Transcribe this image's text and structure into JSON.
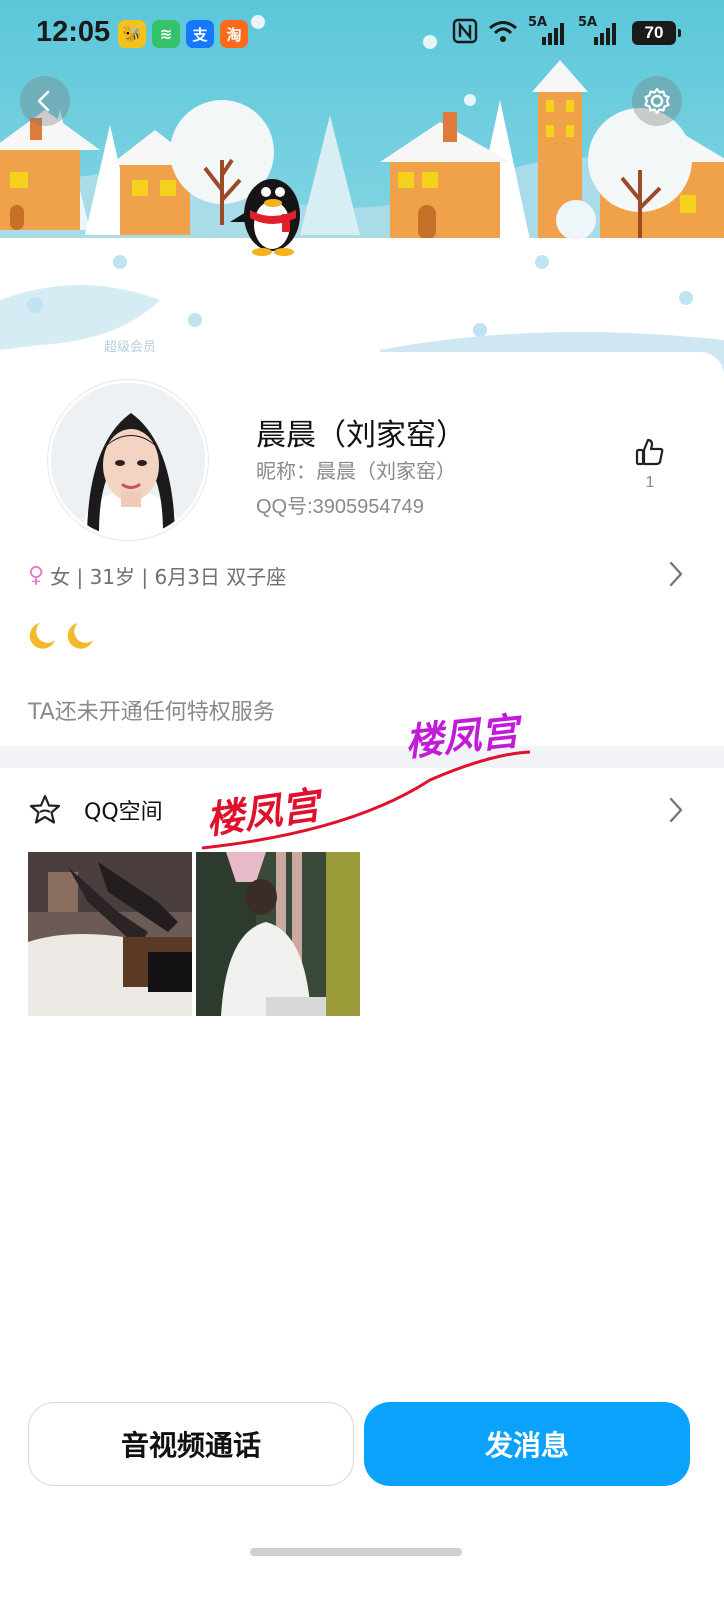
{
  "status_bar": {
    "time": "12:05",
    "apps": [
      {
        "name": "taobao-bee-app",
        "color": "#f6c21a",
        "glyph": "🐝"
      },
      {
        "name": "wifi-share-app",
        "color": "#34c36a",
        "glyph": "≋"
      },
      {
        "name": "alipay-app",
        "color": "#1677ff",
        "glyph": "支"
      },
      {
        "name": "taobao-flash-app",
        "color": "#ff6a1a",
        "glyph": "淘"
      }
    ],
    "signal_1_label": "5A",
    "signal_2_label": "5A",
    "battery": "70"
  },
  "banner": {
    "watermark_text": "超级会员"
  },
  "profile": {
    "name": "晨晨（刘家窑）",
    "nickname": "昵称：晨晨（刘家窑）",
    "qq_number": "QQ号:3905954749",
    "like_count": "1",
    "gender_symbol": "♀",
    "info": "女 | 31岁 | 6月3日 双子座",
    "signature_emoji": [
      "🌙",
      "🌙"
    ],
    "privilege_text": "TA还未开通任何特权服务"
  },
  "qzone": {
    "label": "QQ空间"
  },
  "watermarks": {
    "text_1": "楼凤宫",
    "text_2": "楼凤宫",
    "color_1": "#e0112d",
    "color_2": "#c21bd8"
  },
  "actions": {
    "call_label": "音视频通话",
    "message_label": "发消息"
  },
  "colors": {
    "primary": "#0aa2fb",
    "banner_sky": "#5bc7d9"
  }
}
